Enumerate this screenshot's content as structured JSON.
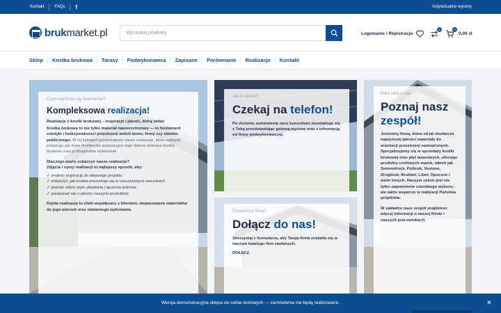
{
  "topbar": {
    "links": [
      "Kontakt",
      "FAQs"
    ],
    "facebook_icon": "facebook-icon",
    "right_link": "Indywidualne wyceny"
  },
  "header": {
    "logo_bold": "bruk",
    "logo_rest": "market.pl",
    "search_placeholder": "Wyszukaj produkty",
    "login_label": "Logowanie / Rejestracja",
    "wishlist_count": "0",
    "compare_count": "0",
    "cart_count": "0",
    "cart_total": "0,00 zł"
  },
  "nav": {
    "items": [
      "Sklep",
      "Kostka brukowa",
      "Tarasy",
      "Podwykonawca",
      "Zapisane",
      "Porównanie",
      "Realizacje",
      "Kontakt"
    ]
  },
  "cards": {
    "realizacje": {
      "eyebrow": "Czym wyróżnia się brukmarket?",
      "title_plain": "Kompleksowa ",
      "title_highlight": "realizacja!",
      "intro": "Realizacje z kostki brukowej – inspiracje i jakość, którą widać",
      "body_strong": "Kostka brukowa to nie tylko materiał nawierzchniowy — to fundament estetyki i funkcjonalności przestrzeni wokół domu, firmy czy obiektu publicznego.",
      "body_rest": " W tej kategorii prezentujemy nasze realizacje, które najlepiej pokazują, jak duże możliwości aranżacyjne daje dobrze dobrana kostka brukowa oraz profesjonalne wykonanie.",
      "question": "Dlaczego warto zobaczyć nasze realizacje?",
      "question_sub": "Zdjęcia i opisy realizacji to najlepszy sposób, aby:",
      "bullets": [
        "✓ znaleźć inspirację do własnego projektu",
        "✓ zobaczyć, jak kostka prezentuje się w rzeczywistych warunkach",
        "✓ poznać różne style układania i łączenia kolorów",
        "✓ przekonać się o jakości naszych produktów"
      ],
      "closing": "Każda realizacja to efekt współpracy z klientem, dopasowania materiałów do jego potrzeb oraz starannego wykonania."
    },
    "telefon": {
      "eyebrow": "Jak to działa?",
      "title_plain": "Czekaj na ",
      "title_highlight": "telefon!",
      "body": "Po złożeniu zamówienia nasz konsultant skontaktuje się z Tobą przedstawiając gotową wycenę oraz z informacją od firmy podwykonawczej."
    },
    "dolacz": {
      "eyebrow": "Prowadzisz firmę?",
      "title_plain": "Dołącz ",
      "title_highlight": "do nas!",
      "body": "Skorzystaj z formularza, aby Twoja firma znalazła się w naszym katalogu firm zaufanych.",
      "cta": "DOŁĄCZ"
    },
    "zespol": {
      "eyebrow": "Kilka słów o nas",
      "title_plain": "Poznaj nasz ",
      "title_highlight": "zespół!",
      "body": "Jesteśmy firmą, która od lat dostarcza najwyższej jakości materiały do aranżacji przestrzeni zewnętrznych. Specjalizujemy się w sprzedaży kostki brukowej oraz płyt tarasowych, oferując produkty czołowych marek, takich jak Semmelrock, Polbruk, Vestone, Drogbruk, Brukbet, Libet, Opoczno i wiele innych. Naszym celem jest nie tylko zapewnienie szerokiego wyboru, ale także wsparcie w realizacji Państwa projektów.",
      "body2": "W zakładce nasz zespół znajdziesz więcej informacji o naszej firmie i naszych pracownikach."
    }
  },
  "cookie": {
    "text": "Wersja demonstracyjna sklepu do celów testowych — zamówienia nie będą realizowane.",
    "close_icon": "close-icon"
  },
  "colors": {
    "brand": "#0f4d92",
    "text_dark": "#1f2a44"
  }
}
